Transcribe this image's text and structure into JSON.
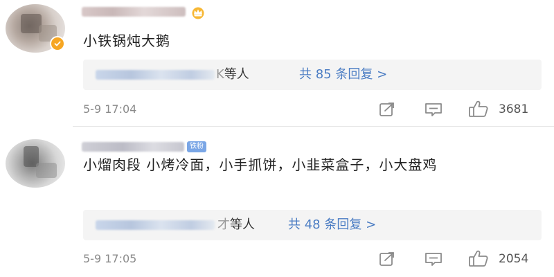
{
  "comments": [
    {
      "content": "小铁锅炖大鹅",
      "reply": {
        "tail_fade": "K",
        "tail": "等人",
        "link": "共 85 条回复 >"
      },
      "time": "5-9 17:04",
      "likes": "3681"
    },
    {
      "content": "小熘肉段 小烤冷面，小手抓饼，小韭菜盒子，小大盘鸡",
      "fan_badge": "铁粉",
      "reply": {
        "tail_fade": "才",
        "tail": "等人",
        "link": "共 48 条回复 >"
      },
      "time": "5-9 17:05",
      "likes": "2054"
    }
  ],
  "icons": {
    "share": "share-icon",
    "comment": "comment-icon",
    "like": "thumbs-up-icon",
    "crown": "crown-icon",
    "verified": "verified-badge-icon"
  },
  "colors": {
    "link": "#4a7cc3",
    "meta_text": "#8a8a8a",
    "reply_bg": "#f4f4f4",
    "verified_badge": "#f6a623",
    "fan_badge": "#7aa6e6"
  }
}
